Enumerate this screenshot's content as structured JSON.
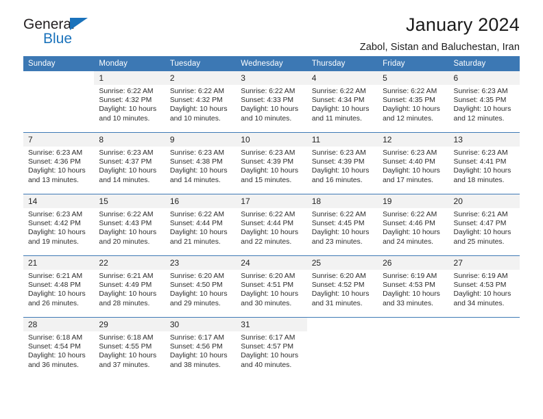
{
  "brand": {
    "name_top": "General",
    "name_bottom": "Blue",
    "triangle_color": "#1a72bb"
  },
  "header": {
    "title": "January 2024",
    "subtitle": "Zabol, Sistan and Baluchestan, Iran"
  },
  "theme": {
    "header_bg": "#3c78b4",
    "header_text": "#ffffff",
    "daynum_bg": "#f2f2f2",
    "row_divider": "#3c78b4"
  },
  "weekday_headers": [
    "Sunday",
    "Monday",
    "Tuesday",
    "Wednesday",
    "Thursday",
    "Friday",
    "Saturday"
  ],
  "labels": {
    "sunrise_prefix": "Sunrise: ",
    "sunset_prefix": "Sunset: ",
    "daylight_prefix": "Daylight: "
  },
  "weeks": [
    [
      {
        "empty": true
      },
      {
        "day": "1",
        "sunrise": "Sunrise: 6:22 AM",
        "sunset": "Sunset: 4:32 PM",
        "daylight1": "Daylight: 10 hours",
        "daylight2": "and 10 minutes."
      },
      {
        "day": "2",
        "sunrise": "Sunrise: 6:22 AM",
        "sunset": "Sunset: 4:32 PM",
        "daylight1": "Daylight: 10 hours",
        "daylight2": "and 10 minutes."
      },
      {
        "day": "3",
        "sunrise": "Sunrise: 6:22 AM",
        "sunset": "Sunset: 4:33 PM",
        "daylight1": "Daylight: 10 hours",
        "daylight2": "and 10 minutes."
      },
      {
        "day": "4",
        "sunrise": "Sunrise: 6:22 AM",
        "sunset": "Sunset: 4:34 PM",
        "daylight1": "Daylight: 10 hours",
        "daylight2": "and 11 minutes."
      },
      {
        "day": "5",
        "sunrise": "Sunrise: 6:22 AM",
        "sunset": "Sunset: 4:35 PM",
        "daylight1": "Daylight: 10 hours",
        "daylight2": "and 12 minutes."
      },
      {
        "day": "6",
        "sunrise": "Sunrise: 6:23 AM",
        "sunset": "Sunset: 4:35 PM",
        "daylight1": "Daylight: 10 hours",
        "daylight2": "and 12 minutes."
      }
    ],
    [
      {
        "day": "7",
        "sunrise": "Sunrise: 6:23 AM",
        "sunset": "Sunset: 4:36 PM",
        "daylight1": "Daylight: 10 hours",
        "daylight2": "and 13 minutes."
      },
      {
        "day": "8",
        "sunrise": "Sunrise: 6:23 AM",
        "sunset": "Sunset: 4:37 PM",
        "daylight1": "Daylight: 10 hours",
        "daylight2": "and 14 minutes."
      },
      {
        "day": "9",
        "sunrise": "Sunrise: 6:23 AM",
        "sunset": "Sunset: 4:38 PM",
        "daylight1": "Daylight: 10 hours",
        "daylight2": "and 14 minutes."
      },
      {
        "day": "10",
        "sunrise": "Sunrise: 6:23 AM",
        "sunset": "Sunset: 4:39 PM",
        "daylight1": "Daylight: 10 hours",
        "daylight2": "and 15 minutes."
      },
      {
        "day": "11",
        "sunrise": "Sunrise: 6:23 AM",
        "sunset": "Sunset: 4:39 PM",
        "daylight1": "Daylight: 10 hours",
        "daylight2": "and 16 minutes."
      },
      {
        "day": "12",
        "sunrise": "Sunrise: 6:23 AM",
        "sunset": "Sunset: 4:40 PM",
        "daylight1": "Daylight: 10 hours",
        "daylight2": "and 17 minutes."
      },
      {
        "day": "13",
        "sunrise": "Sunrise: 6:23 AM",
        "sunset": "Sunset: 4:41 PM",
        "daylight1": "Daylight: 10 hours",
        "daylight2": "and 18 minutes."
      }
    ],
    [
      {
        "day": "14",
        "sunrise": "Sunrise: 6:23 AM",
        "sunset": "Sunset: 4:42 PM",
        "daylight1": "Daylight: 10 hours",
        "daylight2": "and 19 minutes."
      },
      {
        "day": "15",
        "sunrise": "Sunrise: 6:22 AM",
        "sunset": "Sunset: 4:43 PM",
        "daylight1": "Daylight: 10 hours",
        "daylight2": "and 20 minutes."
      },
      {
        "day": "16",
        "sunrise": "Sunrise: 6:22 AM",
        "sunset": "Sunset: 4:44 PM",
        "daylight1": "Daylight: 10 hours",
        "daylight2": "and 21 minutes."
      },
      {
        "day": "17",
        "sunrise": "Sunrise: 6:22 AM",
        "sunset": "Sunset: 4:44 PM",
        "daylight1": "Daylight: 10 hours",
        "daylight2": "and 22 minutes."
      },
      {
        "day": "18",
        "sunrise": "Sunrise: 6:22 AM",
        "sunset": "Sunset: 4:45 PM",
        "daylight1": "Daylight: 10 hours",
        "daylight2": "and 23 minutes."
      },
      {
        "day": "19",
        "sunrise": "Sunrise: 6:22 AM",
        "sunset": "Sunset: 4:46 PM",
        "daylight1": "Daylight: 10 hours",
        "daylight2": "and 24 minutes."
      },
      {
        "day": "20",
        "sunrise": "Sunrise: 6:21 AM",
        "sunset": "Sunset: 4:47 PM",
        "daylight1": "Daylight: 10 hours",
        "daylight2": "and 25 minutes."
      }
    ],
    [
      {
        "day": "21",
        "sunrise": "Sunrise: 6:21 AM",
        "sunset": "Sunset: 4:48 PM",
        "daylight1": "Daylight: 10 hours",
        "daylight2": "and 26 minutes."
      },
      {
        "day": "22",
        "sunrise": "Sunrise: 6:21 AM",
        "sunset": "Sunset: 4:49 PM",
        "daylight1": "Daylight: 10 hours",
        "daylight2": "and 28 minutes."
      },
      {
        "day": "23",
        "sunrise": "Sunrise: 6:20 AM",
        "sunset": "Sunset: 4:50 PM",
        "daylight1": "Daylight: 10 hours",
        "daylight2": "and 29 minutes."
      },
      {
        "day": "24",
        "sunrise": "Sunrise: 6:20 AM",
        "sunset": "Sunset: 4:51 PM",
        "daylight1": "Daylight: 10 hours",
        "daylight2": "and 30 minutes."
      },
      {
        "day": "25",
        "sunrise": "Sunrise: 6:20 AM",
        "sunset": "Sunset: 4:52 PM",
        "daylight1": "Daylight: 10 hours",
        "daylight2": "and 31 minutes."
      },
      {
        "day": "26",
        "sunrise": "Sunrise: 6:19 AM",
        "sunset": "Sunset: 4:53 PM",
        "daylight1": "Daylight: 10 hours",
        "daylight2": "and 33 minutes."
      },
      {
        "day": "27",
        "sunrise": "Sunrise: 6:19 AM",
        "sunset": "Sunset: 4:53 PM",
        "daylight1": "Daylight: 10 hours",
        "daylight2": "and 34 minutes."
      }
    ],
    [
      {
        "day": "28",
        "sunrise": "Sunrise: 6:18 AM",
        "sunset": "Sunset: 4:54 PM",
        "daylight1": "Daylight: 10 hours",
        "daylight2": "and 36 minutes."
      },
      {
        "day": "29",
        "sunrise": "Sunrise: 6:18 AM",
        "sunset": "Sunset: 4:55 PM",
        "daylight1": "Daylight: 10 hours",
        "daylight2": "and 37 minutes."
      },
      {
        "day": "30",
        "sunrise": "Sunrise: 6:17 AM",
        "sunset": "Sunset: 4:56 PM",
        "daylight1": "Daylight: 10 hours",
        "daylight2": "and 38 minutes."
      },
      {
        "day": "31",
        "sunrise": "Sunrise: 6:17 AM",
        "sunset": "Sunset: 4:57 PM",
        "daylight1": "Daylight: 10 hours",
        "daylight2": "and 40 minutes."
      },
      {
        "empty": true
      },
      {
        "empty": true
      },
      {
        "empty": true
      }
    ]
  ]
}
